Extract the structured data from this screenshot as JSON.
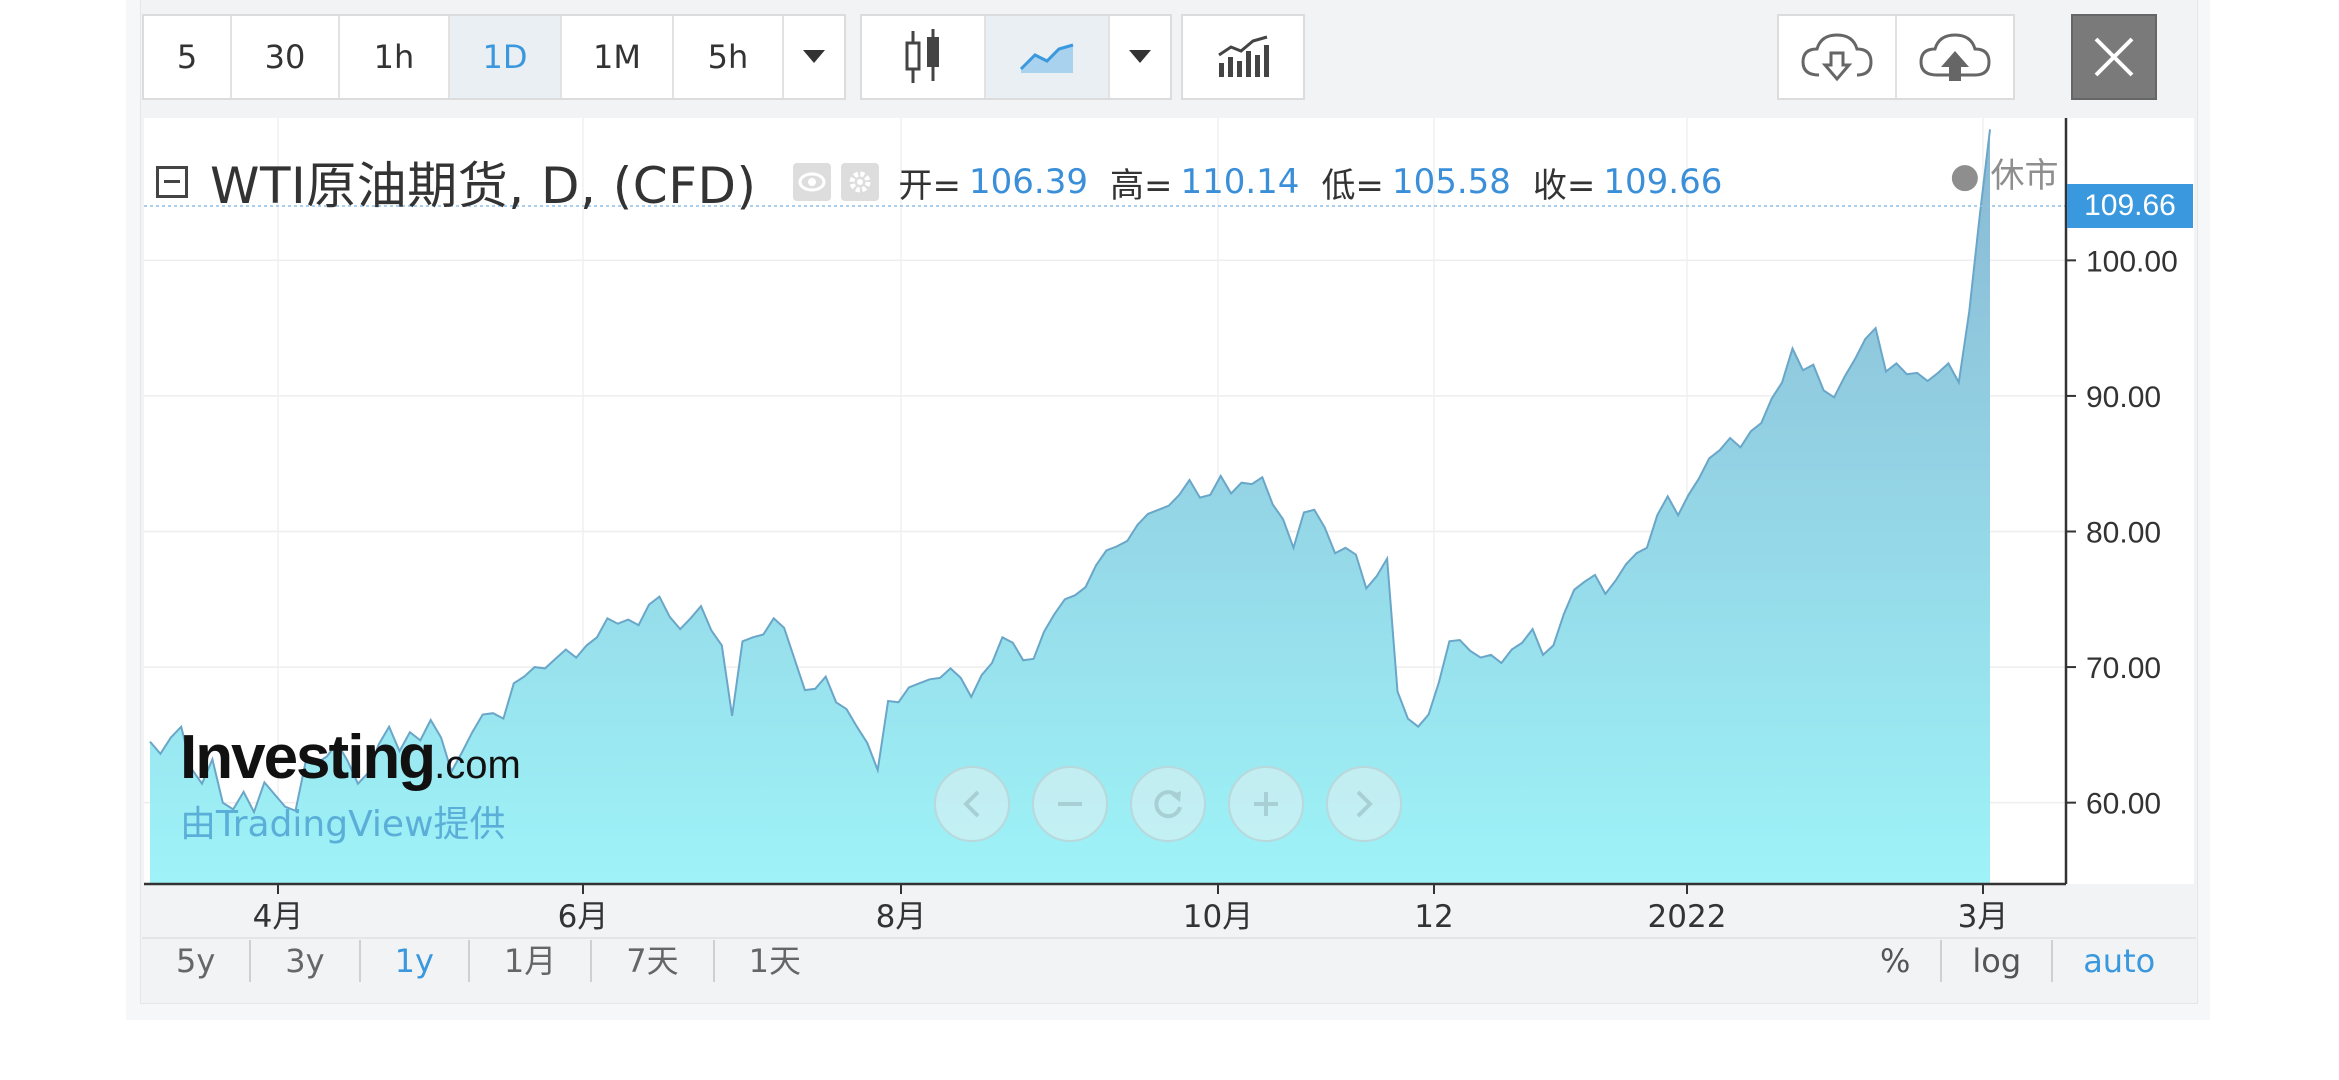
{
  "toolbar": {
    "intervals": [
      {
        "label": "5"
      },
      {
        "label": "30"
      },
      {
        "label": "1h"
      },
      {
        "label": "1D"
      },
      {
        "label": "1M"
      },
      {
        "label": "5h"
      }
    ],
    "active_interval": "1D"
  },
  "legend": {
    "title": "WTI原油期货, D, (CFD)",
    "open_label": "开=",
    "open": "106.39",
    "high_label": "高=",
    "high": "110.14",
    "low_label": "低=",
    "low": "105.58",
    "close_label": "收=",
    "close": "109.66",
    "status": "● 休市"
  },
  "price_tag": "109.66",
  "watermark": {
    "logo": "Investing",
    "logo_suffix": ".com",
    "sub": "由TradingView提供"
  },
  "range_buttons": [
    {
      "label": "5y"
    },
    {
      "label": "3y"
    },
    {
      "label": "1y"
    },
    {
      "label": "1月"
    },
    {
      "label": "7天"
    },
    {
      "label": "1天"
    }
  ],
  "active_range": "1y",
  "scale_buttons": [
    {
      "label": "%"
    },
    {
      "label": "log"
    },
    {
      "label": "auto"
    }
  ],
  "active_scale": "auto",
  "colors": {
    "accent": "#3a98de",
    "area_top": "#8ab8d4",
    "area_bottom": "#9ef3f8",
    "line": "#6aa6c8"
  },
  "chart_data": {
    "type": "area",
    "x_tick_labels": [
      "4月",
      "6月",
      "8月",
      "10月",
      "12",
      "2022",
      "3月"
    ],
    "y_tick_labels": [
      "60.00",
      "70.00",
      "80.00",
      "90.00",
      "100.00"
    ],
    "ylim": [
      54,
      110.5
    ],
    "grid": true,
    "series": [
      {
        "values": [
          64.5,
          63.6,
          64.8,
          65.6,
          62.5,
          61.4,
          63.2,
          60.0,
          59.5,
          60.8,
          59.3,
          61.5,
          60.6,
          59.7,
          59.4,
          63.1,
          62.9,
          63.4,
          64.4,
          63.1,
          61.4,
          62.2,
          64.3,
          65.6,
          63.8,
          65.2,
          64.6,
          66.1,
          64.8,
          62.3,
          63.7,
          65.2,
          66.5,
          66.6,
          66.2,
          68.8,
          69.3,
          70.0,
          69.9,
          70.6,
          71.3,
          70.7,
          71.6,
          72.2,
          73.6,
          73.2,
          73.5,
          73.1,
          74.6,
          75.2,
          73.7,
          72.8,
          73.6,
          74.5,
          72.7,
          71.6,
          66.4,
          71.9,
          72.2,
          72.4,
          73.6,
          72.9,
          70.6,
          68.3,
          68.4,
          69.3,
          67.4,
          66.9,
          65.6,
          64.4,
          62.4,
          67.5,
          67.4,
          68.5,
          68.8,
          69.1,
          69.2,
          69.9,
          69.2,
          67.8,
          69.4,
          70.3,
          72.2,
          71.8,
          70.5,
          70.6,
          72.6,
          73.9,
          75.0,
          75.3,
          75.9,
          77.5,
          78.6,
          78.9,
          79.3,
          80.5,
          81.3,
          81.6,
          81.9,
          82.7,
          83.8,
          82.5,
          82.7,
          84.1,
          82.8,
          83.6,
          83.5,
          84.0,
          82.0,
          80.9,
          78.8,
          81.4,
          81.6,
          80.3,
          78.4,
          78.8,
          78.3,
          75.8,
          76.7,
          78.0,
          68.2,
          66.2,
          65.6,
          66.5,
          68.9,
          71.9,
          72.0,
          71.2,
          70.7,
          70.9,
          70.3,
          71.3,
          71.8,
          72.8,
          70.9,
          71.6,
          73.9,
          75.7,
          76.3,
          76.8,
          75.4,
          76.4,
          77.6,
          78.4,
          78.8,
          81.2,
          82.6,
          81.2,
          82.7,
          83.9,
          85.4,
          86.0,
          86.9,
          86.2,
          87.4,
          88.0,
          89.8,
          91.0,
          93.5,
          91.9,
          92.3,
          90.4,
          89.9,
          91.4,
          92.7,
          94.2,
          95.0,
          91.8,
          92.4,
          91.6,
          91.7,
          91.1,
          91.7,
          92.4,
          91.0,
          96.2,
          103.2,
          109.66
        ]
      }
    ]
  }
}
